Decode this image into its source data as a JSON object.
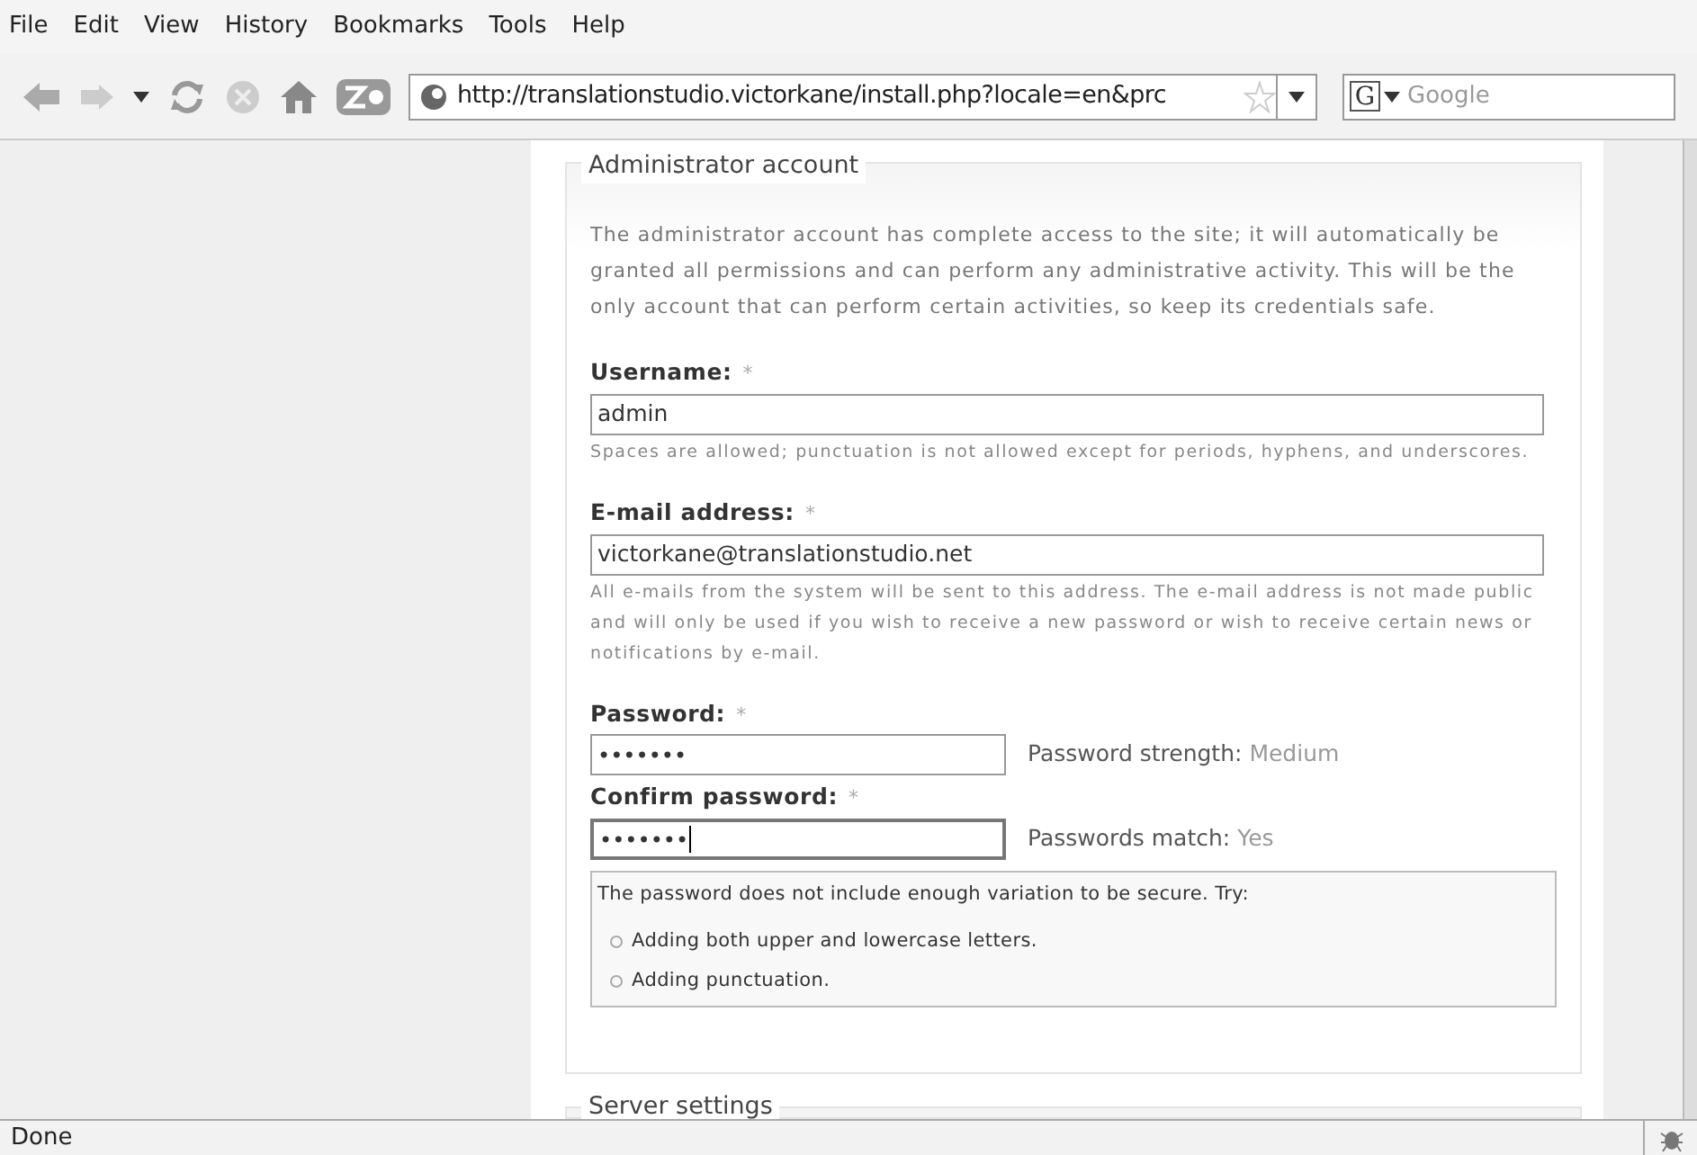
{
  "menu": [
    "File",
    "Edit",
    "View",
    "History",
    "Bookmarks",
    "Tools",
    "Help"
  ],
  "toolbar": {
    "url": "http://translationstudio.victorkane/install.php?locale=en&prc",
    "search_engine_label": "G",
    "search_placeholder": "Google"
  },
  "fieldset": {
    "legend": "Administrator account",
    "description": "The administrator account has complete access to the site; it will automatically be granted all permissions and can perform any administrative activity. This will be the only account that can perform certain activities, so keep its credentials safe.",
    "fields": [
      {
        "kind": "text",
        "label": "Username:",
        "required": "*",
        "value": "admin",
        "help": "Spaces are allowed; punctuation is not allowed except for periods, hyphens, and underscores."
      },
      {
        "kind": "text",
        "label": "E-mail address:",
        "required": "*",
        "value": "victorkane@translationstudio.net",
        "help": "All e-mails from the system will be sent to this address. The e-mail address is not made public and will only be used if you wish to receive a new password or wish to receive certain news or notifications by e-mail."
      },
      {
        "kind": "password",
        "label": "Password:",
        "required": "*",
        "value": "•••••••",
        "focused": false,
        "status_label": "Password strength:",
        "status_value": "Medium"
      },
      {
        "kind": "password",
        "label": "Confirm password:",
        "required": "*",
        "value": "•••••••",
        "focused": true,
        "status_label": "Passwords match:",
        "status_value": "Yes"
      }
    ],
    "advice": {
      "title": "The password does not include enough variation to be secure. Try:",
      "items": [
        "Adding both upper and lowercase letters.",
        "Adding punctuation."
      ]
    }
  },
  "next_fieldset": {
    "legend": "Server settings"
  },
  "status_bar": {
    "text": "Done"
  }
}
